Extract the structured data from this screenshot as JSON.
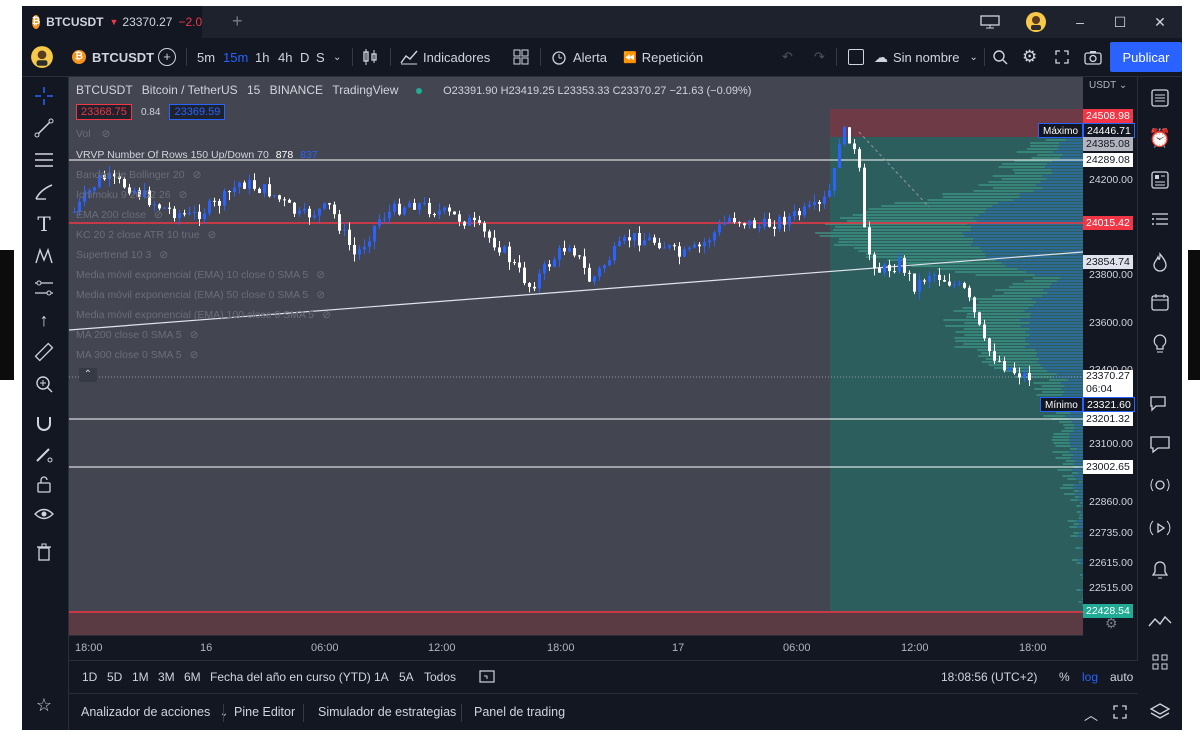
{
  "window": {
    "tab_symbol": "BTCUSDT",
    "tab_arrow": "▼",
    "tab_price": "23370.27",
    "tab_change": "−2.0",
    "new_tab": "+"
  },
  "toolbar": {
    "symbol": "BTCUSDT",
    "add": "+",
    "intervals": [
      "5m",
      "15m",
      "1h",
      "4h",
      "D",
      "S"
    ],
    "indicators": "Indicadores",
    "alert": "Alerta",
    "replay": "Repetición",
    "layout_name": "Sin nombre",
    "publish": "Publicar"
  },
  "legend": {
    "symbol": "BTCUSDT",
    "name": "Bitcoin / TetherUS",
    "interval": "15",
    "exchange": "BINANCE",
    "source": "TradingView",
    "o_label": "O",
    "o": "23391.90",
    "h_label": "H",
    "h": "23419.25",
    "l_label": "L",
    "l": "23353.33",
    "c_label": "C",
    "c": "23370.27",
    "change": "−21.63 (−0.09%)",
    "bid": "23368.75",
    "spread": "0.84",
    "ask": "23369.59",
    "vol": "Vol",
    "vrvp": "VRVP Number Of Rows 150 Up/Down 70",
    "vrvp_up": "878",
    "vrvp_down": "837",
    "indicators": [
      "Bandas de Bollinger 20",
      "Ichimoku 9 26 52 26",
      "EMA 200 close",
      "KC 20 2 close ATR 10 true",
      "Supertrend 10 3",
      "Media móvil exponencial (EMA) 10 close 0 SMA 5",
      "Media móvil exponencial (EMA) 50 close 0 SMA 5",
      "Media móvil exponencial (EMA) 100 close 0 SMA 5",
      "MA 200 close 0 SMA 5",
      "MA 300 close 0 SMA 5"
    ]
  },
  "price_axis": {
    "currency": "USDT",
    "ticks": [
      "24200.00",
      "23800.00",
      "23600.00",
      "23400.00",
      "23100.00",
      "22860.00",
      "22735.00",
      "22615.00",
      "22515.00"
    ],
    "level_24508": "24508.98",
    "max_label": "Máximo",
    "max_value": "24446.71",
    "level_24385": "24385.08",
    "level_24289": "24289.08",
    "level_24015": "24015.42",
    "level_23854": "23854.74",
    "last_price": "23370.27",
    "countdown": "06:04",
    "min_label": "Mínimo",
    "min_value": "23321.60",
    "level_23201": "23201.32",
    "level_23002": "23002.65",
    "level_22428": "22428.54"
  },
  "time_axis": [
    "18:00",
    "16",
    "06:00",
    "12:00",
    "18:00",
    "17",
    "06:00",
    "12:00",
    "18:00"
  ],
  "range_bar": {
    "ranges": [
      "1D",
      "5D",
      "1M",
      "3M",
      "6M",
      "Fecha del año en curso (YTD)",
      "1A",
      "5A",
      "Todos"
    ],
    "clock": "18:08:56 (UTC+2)",
    "percent": "%",
    "log": "log",
    "auto": "auto"
  },
  "bottom_tabs": [
    "Analizador de acciones",
    "Pine Editor",
    "Simulador de estrategias",
    "Panel de trading"
  ],
  "colors": {
    "up": "#2962ff",
    "down": "#ffffff",
    "accent": "#2962ff",
    "red_level": "#f23645",
    "zone_green": "#22ab94",
    "zone_red": "#f23645"
  }
}
